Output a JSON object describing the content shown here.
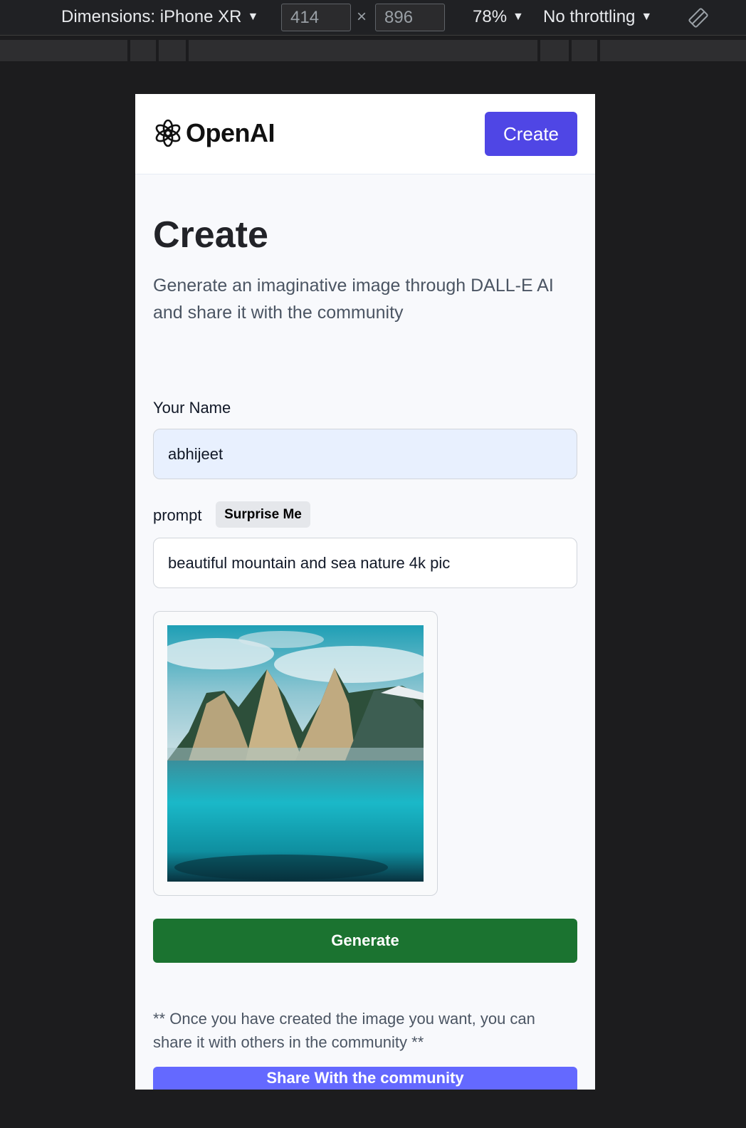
{
  "devtools": {
    "dimensions_label": "Dimensions: iPhone XR",
    "width_value": "414",
    "height_value": "896",
    "times_symbol": "×",
    "zoom": "78%",
    "throttling": "No throttling",
    "caret": "▼",
    "rotate_icon": "rotate-icon"
  },
  "header": {
    "logo_text": "OpenAI",
    "logo_icon": "openai-logo-icon",
    "create_label": "Create"
  },
  "main": {
    "title": "Create",
    "description": "Generate an imaginative image through DALL-E AI and share it with the community"
  },
  "form": {
    "name_label": "Your Name",
    "name_value": "abhijeet",
    "prompt_label": "prompt",
    "surprise_label": "Surprise Me",
    "prompt_value": "beautiful mountain and sea nature 4k pic",
    "generate_label": "Generate"
  },
  "share": {
    "note": "** Once you have created the image you want, you can share it with others in the community **",
    "button_label": "Share With the community"
  },
  "colors": {
    "accent": "#4f46e5",
    "generate": "#1b7330",
    "share": "#6469ff",
    "background": "#f8f9fc"
  }
}
